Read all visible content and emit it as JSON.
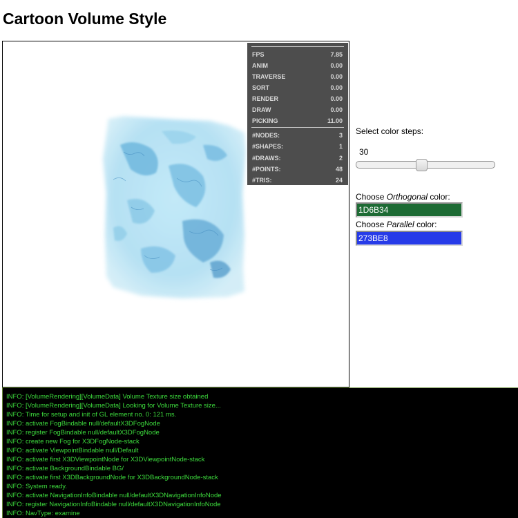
{
  "page": {
    "title": "Cartoon Volume Style"
  },
  "stats": {
    "timing": [
      {
        "label": "FPS",
        "value": "7.85"
      },
      {
        "label": "ANIM",
        "value": "0.00"
      },
      {
        "label": "TRAVERSE",
        "value": "0.00"
      },
      {
        "label": "SORT",
        "value": "0.00"
      },
      {
        "label": "RENDER",
        "value": "0.00"
      },
      {
        "label": "DRAW",
        "value": "0.00"
      },
      {
        "label": "PICKING",
        "value": "11.00"
      }
    ],
    "counts": [
      {
        "label": "#NODES:",
        "value": "3"
      },
      {
        "label": "#SHAPES:",
        "value": "1"
      },
      {
        "label": "#DRAWS:",
        "value": "2"
      },
      {
        "label": "#POINTS:",
        "value": "48"
      },
      {
        "label": "#TRIS:",
        "value": "24"
      }
    ]
  },
  "controls": {
    "steps_label": "Select color steps:",
    "steps_value": "30",
    "slider_level": 0.47,
    "orthogonal_prefix": "Choose ",
    "orthogonal_word": "Orthogonal",
    "orthogonal_suffix": " color:",
    "orthogonal_value": "1D6B34",
    "orthogonal_color": "#1d6b34",
    "parallel_prefix": "Choose ",
    "parallel_word": "Parallel",
    "parallel_suffix": " color:",
    "parallel_value": "273BE8",
    "parallel_color": "#273be8"
  },
  "log": {
    "lines": [
      "INFO: [VolumeRendering][VolumeData] Volume Texture size obtained",
      "INFO: [VolumeRendering][VolumeData] Looking for Volume Texture size...",
      "INFO: Time for setup and init of GL element no. 0: 121 ms.",
      "INFO: activate FogBindable null/defaultX3DFogNode",
      "INFO: register FogBindable null/defaultX3DFogNode",
      "INFO: create new Fog for X3DFogNode-stack",
      "INFO: activate ViewpointBindable null/Default",
      "INFO: activate first X3DViewpointNode for X3DViewpointNode-stack",
      "INFO: activate BackgroundBindable BG/",
      "INFO: activate first X3DBackgroundNode for X3DBackgroundNode-stack",
      "INFO: System ready.",
      "INFO: activate NavigationInfoBindable null/defaultX3DNavigationInfoNode",
      "INFO: register NavigationInfoBindable null/defaultX3DNavigationInfoNode",
      "INFO: NavType: examine"
    ],
    "text_color": "#3ddc3d"
  }
}
